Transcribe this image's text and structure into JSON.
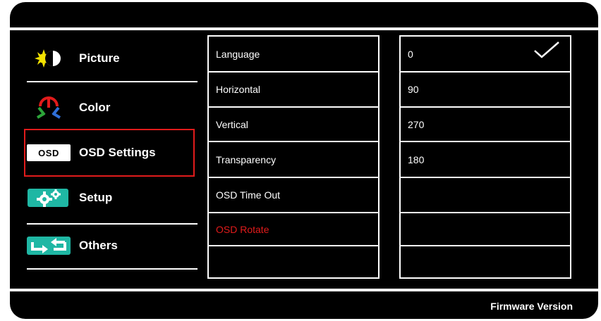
{
  "sidebar": {
    "items": [
      {
        "label": "Picture",
        "icon": "picture-icon"
      },
      {
        "label": "Color",
        "icon": "color-icon"
      },
      {
        "label": "OSD Settings",
        "icon": "osd-icon",
        "badge": "OSD",
        "selected": true
      },
      {
        "label": "Setup",
        "icon": "gear-icon"
      },
      {
        "label": "Others",
        "icon": "arrows-icon"
      }
    ]
  },
  "menu": {
    "items": [
      {
        "label": "Language"
      },
      {
        "label": "Horizontal"
      },
      {
        "label": "Vertical"
      },
      {
        "label": "Transparency"
      },
      {
        "label": "OSD Time Out"
      },
      {
        "label": "OSD Rotate",
        "active": true
      },
      {
        "label": ""
      }
    ]
  },
  "values": {
    "items": [
      "0",
      "90",
      "270",
      "180",
      "",
      "",
      ""
    ],
    "checked_index": 0
  },
  "footer": {
    "label": "Firmware Version"
  },
  "colors": {
    "background": "#000000",
    "text": "#ffffff",
    "highlight": "#e11b1b",
    "icon_teal": "#1fb7a4"
  }
}
